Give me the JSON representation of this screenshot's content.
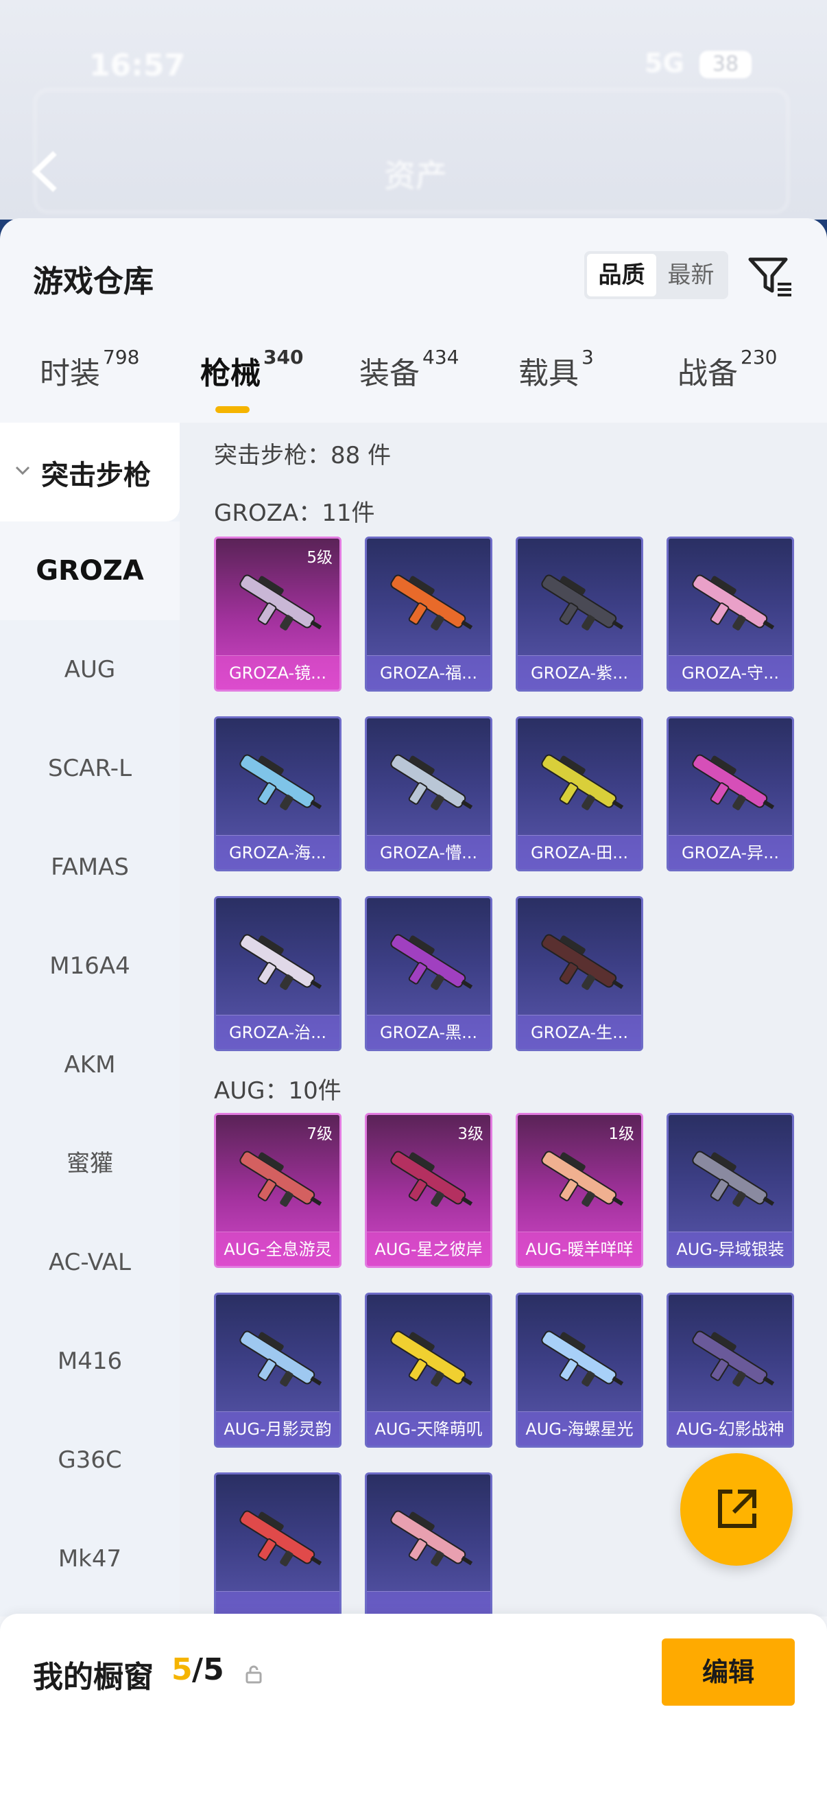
{
  "status": {
    "time": "16:57",
    "network": "5G",
    "battery": "38"
  },
  "nav": {
    "title": "资产"
  },
  "header": {
    "title": "游戏仓库",
    "sort": [
      "品质",
      "最新"
    ]
  },
  "tabs": [
    {
      "label": "时装",
      "count": "798"
    },
    {
      "label": "枪械",
      "count": "340"
    },
    {
      "label": "装备",
      "count": "434"
    },
    {
      "label": "载具",
      "count": "3"
    },
    {
      "label": "战备",
      "count": "230"
    }
  ],
  "sidebar": {
    "category": "突击步枪",
    "items": [
      "GROZA",
      "AUG",
      "SCAR-L",
      "FAMAS",
      "M16A4",
      "AKM",
      "蜜獾",
      "AC-VAL",
      "M416",
      "G36C",
      "Mk47"
    ]
  },
  "content": {
    "category_total": "突击步枪：88 件",
    "groups": [
      {
        "title": "GROZA：11件",
        "items": [
          {
            "name": "GROZA-镜...",
            "level": "5级",
            "rarity": "pink"
          },
          {
            "name": "GROZA-福...",
            "level": "",
            "rarity": "purple"
          },
          {
            "name": "GROZA-紫...",
            "level": "",
            "rarity": "purple"
          },
          {
            "name": "GROZA-守...",
            "level": "",
            "rarity": "purple"
          },
          {
            "name": "GROZA-海...",
            "level": "",
            "rarity": "purple"
          },
          {
            "name": "GROZA-懵...",
            "level": "",
            "rarity": "purple"
          },
          {
            "name": "GROZA-田...",
            "level": "",
            "rarity": "purple"
          },
          {
            "name": "GROZA-异...",
            "level": "",
            "rarity": "purple"
          },
          {
            "name": "GROZA-治...",
            "level": "",
            "rarity": "purple"
          },
          {
            "name": "GROZA-黑...",
            "level": "",
            "rarity": "purple"
          },
          {
            "name": "GROZA-生...",
            "level": "",
            "rarity": "purple"
          }
        ]
      },
      {
        "title": "AUG：10件",
        "items": [
          {
            "name": "AUG-全息游灵",
            "level": "7级",
            "rarity": "pink"
          },
          {
            "name": "AUG-星之彼岸",
            "level": "3级",
            "rarity": "pink"
          },
          {
            "name": "AUG-暖羊咩咩",
            "level": "1级",
            "rarity": "pink"
          },
          {
            "name": "AUG-异域银装",
            "level": "",
            "rarity": "purple"
          },
          {
            "name": "AUG-月影灵韵",
            "level": "",
            "rarity": "purple"
          },
          {
            "name": "AUG-天降萌叽",
            "level": "",
            "rarity": "purple"
          },
          {
            "name": "AUG-海螺星光",
            "level": "",
            "rarity": "purple"
          },
          {
            "name": "AUG-幻影战神",
            "level": "",
            "rarity": "purple"
          },
          {
            "name": "",
            "level": "",
            "rarity": "purple"
          },
          {
            "name": "",
            "level": "",
            "rarity": "purple"
          }
        ]
      }
    ]
  },
  "bottom": {
    "label": "我的橱窗",
    "used": "5",
    "total": "/5",
    "edit": "编辑"
  },
  "icons": [
    "back-icon",
    "filter-icon",
    "share-icon",
    "lock-icon",
    "chevron-down-icon"
  ]
}
